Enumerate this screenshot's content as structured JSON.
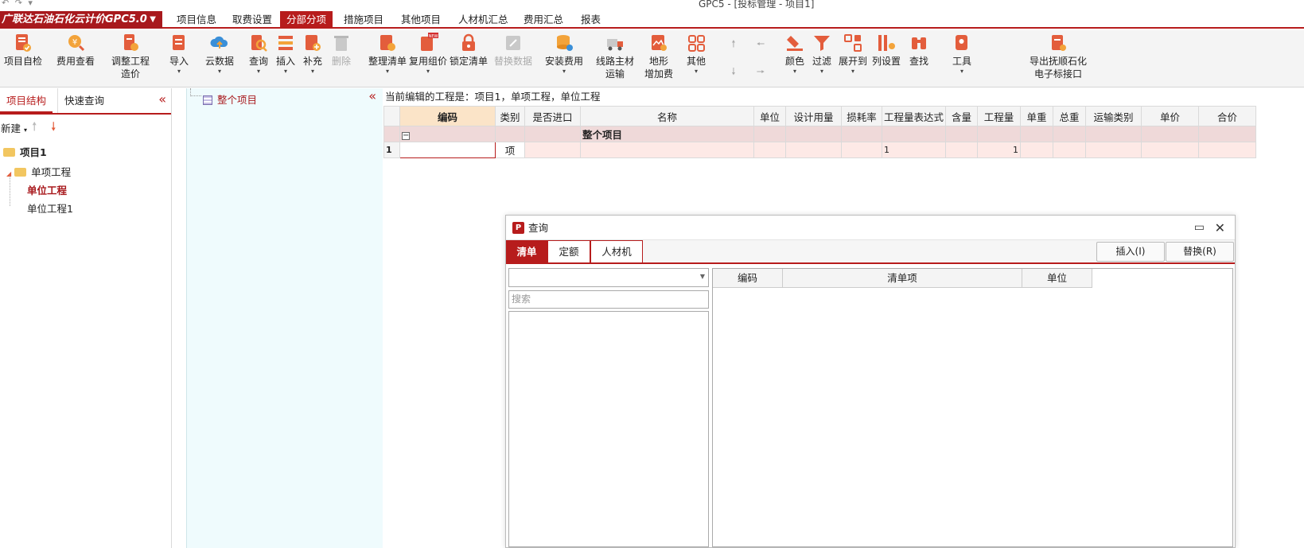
{
  "app": {
    "window_title": "GPC5 - [投标管理 - 项目1]",
    "quick_access": "↶ ↷ ▾",
    "brand": "广联达石油石化云计价GPC5.0"
  },
  "menu": {
    "items": [
      "项目信息",
      "取费设置",
      "分部分项",
      "措施项目",
      "其他项目",
      "人材机汇总",
      "费用汇总",
      "报表"
    ],
    "active_index": 2
  },
  "toolbar": {
    "buttons": [
      {
        "label": "项目自检",
        "icon": "checklist-icon"
      },
      {
        "label": "费用查看",
        "icon": "money-search-icon"
      },
      {
        "label": "调整工程",
        "label2": "造价",
        "icon": "adjust-cost-icon",
        "dropdown": true
      },
      {
        "label": "导入",
        "icon": "import-icon",
        "dropdown": true
      },
      {
        "label": "云数据",
        "icon": "cloud-icon",
        "dropdown": true
      },
      {
        "label": "查询",
        "icon": "query-icon",
        "dropdown": true
      },
      {
        "label": "插入",
        "icon": "insert-icon",
        "dropdown": true
      },
      {
        "label": "补充",
        "icon": "supplement-icon",
        "dropdown": true
      },
      {
        "label": "删除",
        "icon": "trash-icon",
        "disabled": true
      },
      {
        "label": "整理清单",
        "icon": "organize-list-icon",
        "dropdown": true
      },
      {
        "label": "复用组价",
        "icon": "reuse-pricing-icon",
        "dropdown": true,
        "badge": "NEW"
      },
      {
        "label": "锁定清单",
        "icon": "lock-icon"
      },
      {
        "label": "替换数据",
        "icon": "replace-data-icon",
        "disabled": true
      },
      {
        "label": "安装费用",
        "icon": "install-cost-icon",
        "dropdown": true
      },
      {
        "label": "线路主材",
        "label2": "运输",
        "icon": "truck-icon"
      },
      {
        "label": "地形",
        "label2": "增加费",
        "icon": "terrain-icon"
      },
      {
        "label": "其他",
        "icon": "grid-icon",
        "dropdown": true
      },
      {
        "label": "颜色",
        "icon": "color-icon",
        "dropdown": true
      },
      {
        "label": "过滤",
        "icon": "filter-icon",
        "dropdown": true
      },
      {
        "label": "展开到",
        "icon": "expand-icon",
        "dropdown": true
      },
      {
        "label": "列设置",
        "icon": "column-settings-icon"
      },
      {
        "label": "查找",
        "icon": "binoculars-icon"
      },
      {
        "label": "工具",
        "icon": "tools-icon",
        "dropdown": true
      },
      {
        "label": "导出抚顺石化",
        "label2": "电子标接口",
        "icon": "export-icon"
      }
    ]
  },
  "left_panel": {
    "tabs": [
      "项目结构",
      "快速查询"
    ],
    "new_label": "新建",
    "tree": [
      {
        "label": "项目1",
        "level": 0,
        "bold": true
      },
      {
        "label": "单项工程",
        "level": 1
      },
      {
        "label": "单位工程",
        "level": 2,
        "selected": true
      },
      {
        "label": "单位工程1",
        "level": 2
      }
    ]
  },
  "mid_panel": {
    "node": "整个项目"
  },
  "grid": {
    "edit_caption": "当前编辑的工程是：项目1，单项工程，单位工程",
    "columns": [
      "编码",
      "类别",
      "是否进口",
      "名称",
      "单位",
      "设计用量",
      "损耗率",
      "工程量表达式",
      "含量",
      "工程量",
      "单重",
      "总重",
      "运输类别",
      "单价",
      "合价"
    ],
    "group_label": "整个项目",
    "rows": [
      {
        "index": "1",
        "code": "",
        "type": "项",
        "expr": "1",
        "qty": "1"
      }
    ]
  },
  "dialog": {
    "title": "查询",
    "tabs": [
      "清单",
      "定额",
      "人材机"
    ],
    "active_tab": 0,
    "insert_button": "插入(I)",
    "replace_button": "替换(R)",
    "search_placeholder": "搜索",
    "columns": [
      "编码",
      "清单项",
      "单位"
    ]
  },
  "colors": {
    "accent": "#b71c1c",
    "mid_panel_bg": "#effbfd",
    "group_row": "#efd9d9",
    "selected_row": "#fde9e6"
  }
}
